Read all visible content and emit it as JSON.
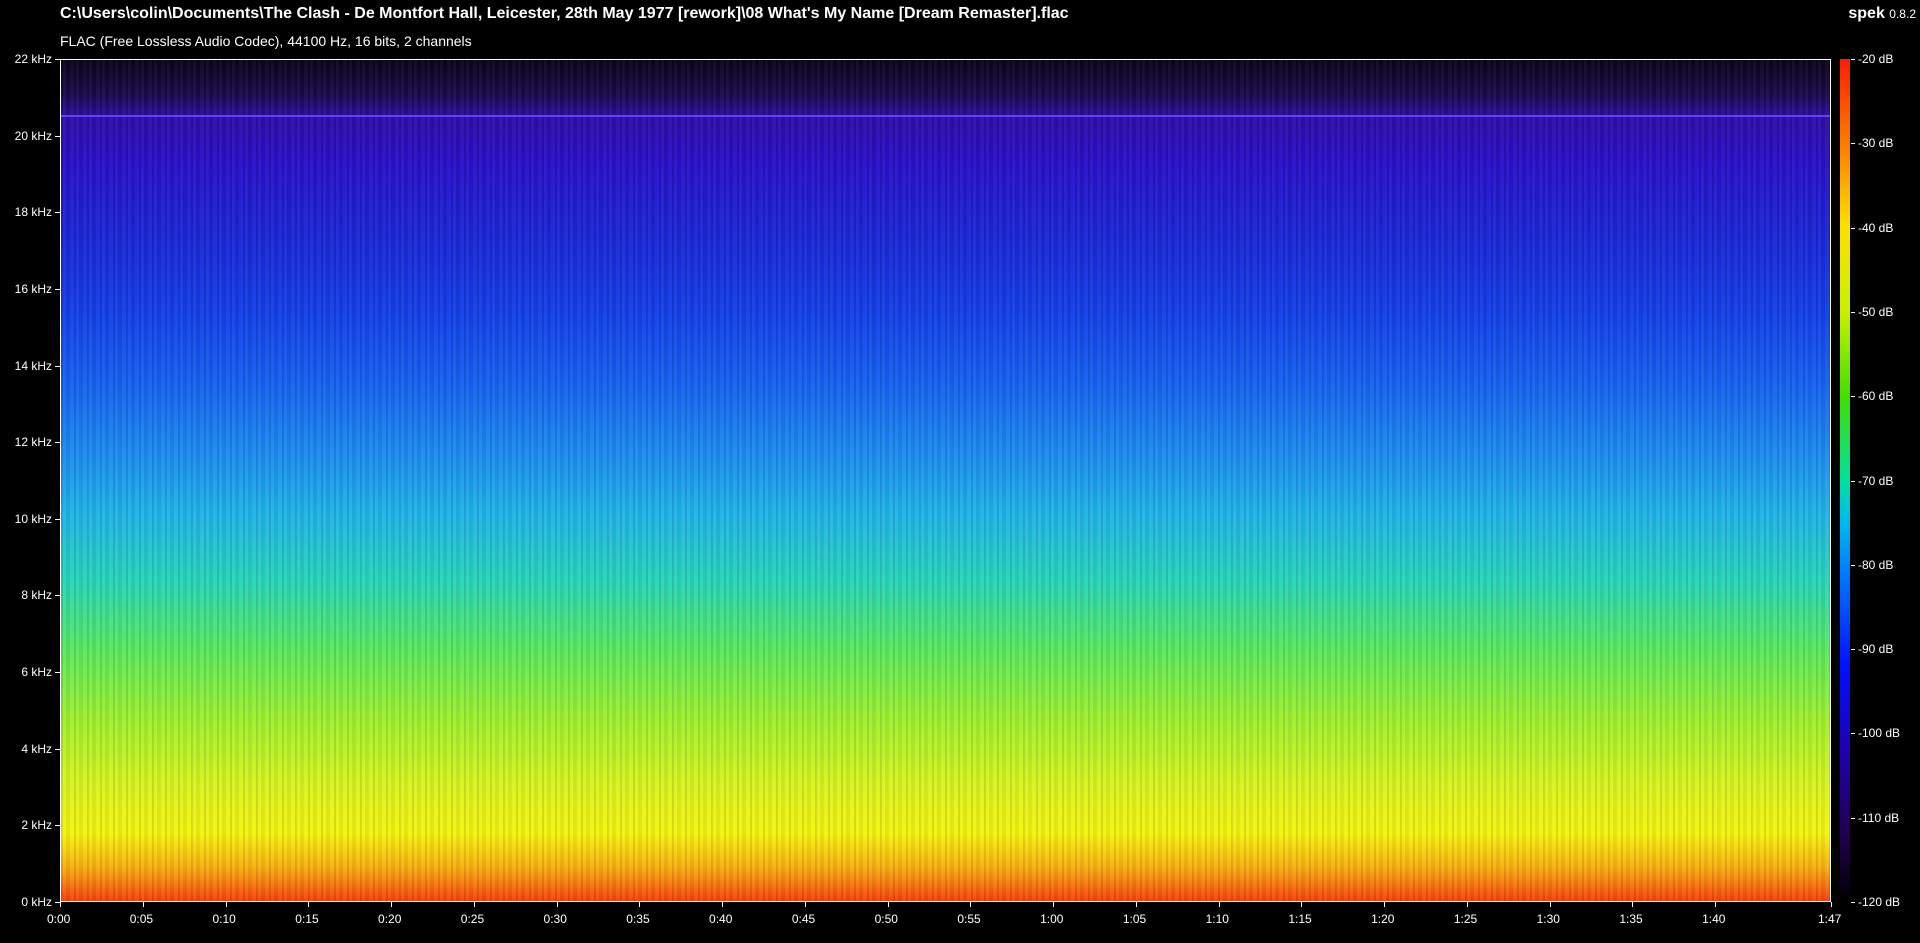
{
  "header": {
    "file_path": "C:\\Users\\colin\\Documents\\The Clash - De Montfort Hall, Leicester, 28th May 1977 [rework]\\08 What's My Name [Dream Remaster].flac",
    "format_info": "FLAC (Free Lossless Audio Codec), 44100 Hz, 16 bits, 2 channels"
  },
  "brand": {
    "name": "spek",
    "version": "0.8.2"
  },
  "frequency_axis": {
    "labels": [
      "22 kHz",
      "20 kHz",
      "18 kHz",
      "16 kHz",
      "14 kHz",
      "12 kHz",
      "10 kHz",
      "8 kHz",
      "6 kHz",
      "4 kHz",
      "2 kHz",
      "0 kHz"
    ]
  },
  "time_axis": {
    "labels": [
      "0:00",
      "0:05",
      "0:10",
      "0:15",
      "0:20",
      "0:25",
      "0:30",
      "0:35",
      "0:40",
      "0:45",
      "0:50",
      "0:55",
      "1:00",
      "1:05",
      "1:10",
      "1:15",
      "1:20",
      "1:25",
      "1:30",
      "1:35",
      "1:40",
      "1:47"
    ]
  },
  "db_scale": {
    "labels": [
      "-20 dB",
      "-30 dB",
      "-40 dB",
      "-50 dB",
      "-60 dB",
      "-70 dB",
      "-80 dB",
      "-90 dB",
      "-100 dB",
      "-110 dB",
      "-120 dB"
    ]
  },
  "colors": {
    "background": "#000000",
    "text": "#ffffff"
  }
}
